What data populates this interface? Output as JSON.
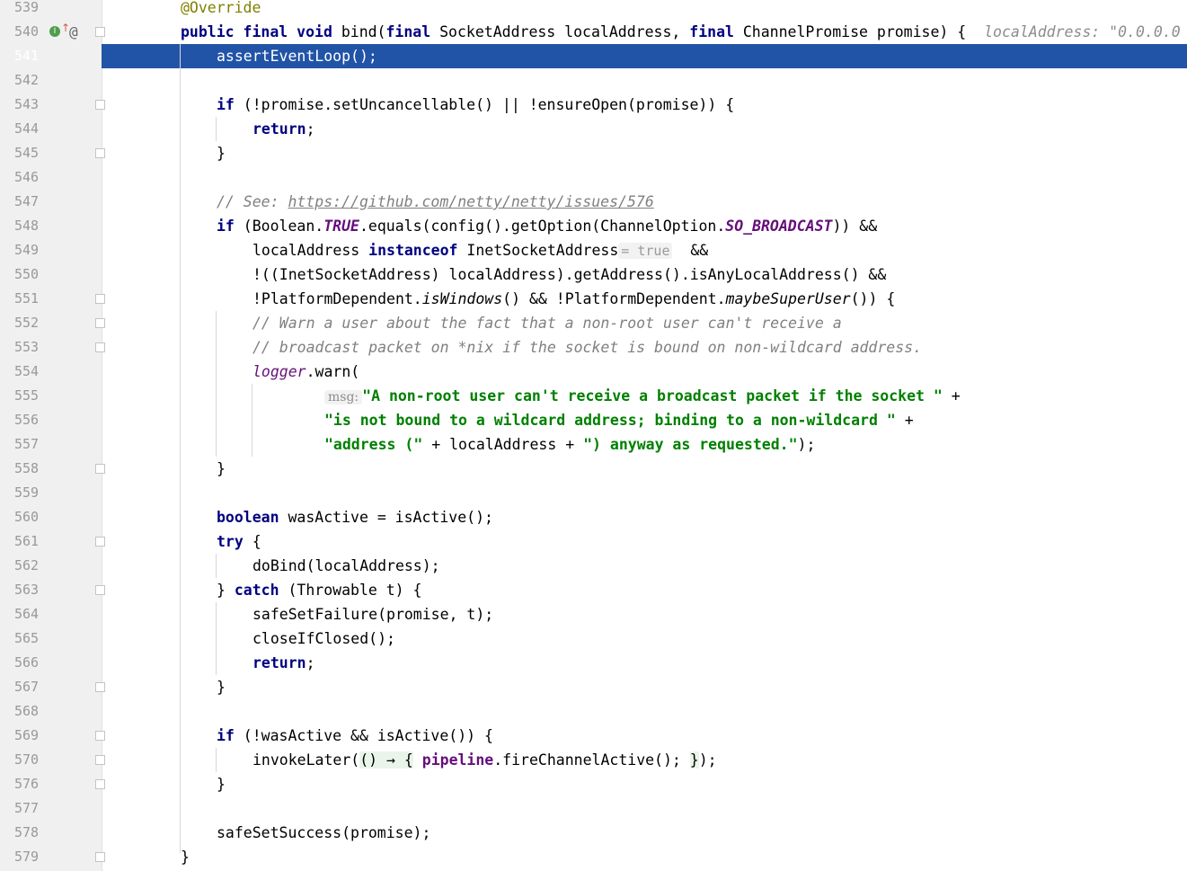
{
  "editor": {
    "line_numbers": [
      "539",
      "540",
      "541",
      "542",
      "543",
      "544",
      "545",
      "546",
      "547",
      "548",
      "549",
      "550",
      "551",
      "552",
      "553",
      "554",
      "555",
      "556",
      "557",
      "558",
      "559",
      "560",
      "561",
      "562",
      "563",
      "564",
      "565",
      "566",
      "567",
      "568",
      "569",
      "570",
      "576",
      "577",
      "578",
      "579"
    ],
    "gutter_icons": {
      "implements_icon": "I",
      "override_icon": "@"
    },
    "code": {
      "l539": {
        "ann": "@Override"
      },
      "l540": {
        "kw1": "public final void",
        "t1": " bind(",
        "kw2": "final",
        "t2": " SocketAddress localAddress, ",
        "kw3": "final",
        "t3": " ChannelPromise promise) {",
        "inlay": "  localAddress: \"0.0.0.0"
      },
      "l541": {
        "t1": "assertEventLoop();"
      },
      "l543": {
        "kw1": "if",
        "t1": " (!promise.setUncancellable() || !ensureOpen(promise)) {"
      },
      "l544": {
        "kw1": "return",
        "t1": ";"
      },
      "l545": {
        "t1": "}"
      },
      "l547": {
        "c1": "// See: ",
        "link": "https://github.com/netty/netty/issues/576"
      },
      "l548": {
        "kw1": "if",
        "t1": " (Boolean.",
        "sf1": "TRUE",
        "t2": ".equals(config().getOption(ChannelOption.",
        "sf2": "SO_BROADCAST",
        "t3": ")) &&"
      },
      "l549": {
        "t1": "localAddress ",
        "kw1": "instanceof",
        "t2": " InetSocketAddress",
        "hint": "= true",
        "t3": "  &&"
      },
      "l550": {
        "t1": "!((InetSocketAddress) localAddress).getAddress().isAnyLocalAddress() &&"
      },
      "l551": {
        "t1": "!PlatformDependent.",
        "i1": "isWindows",
        "t2": "() && !PlatformDependent.",
        "i2": "maybeSuperUser",
        "t3": "()) {"
      },
      "l552": {
        "c1": "// Warn a user about the fact that a non-root user can't receive a"
      },
      "l553": {
        "c1": "// broadcast packet on *nix if the socket is bound on non-wildcard address."
      },
      "l554": {
        "f1": "logger",
        "t1": ".warn("
      },
      "l555": {
        "hint": "msg:",
        "s1": "\"A non-root user can't receive a broadcast packet if the socket \"",
        "t1": " +"
      },
      "l556": {
        "s1": "\"is not bound to a wildcard address; binding to a non-wildcard \"",
        "t1": " +"
      },
      "l557": {
        "s1": "\"address (\"",
        "t1": " + localAddress + ",
        "s2": "\") anyway as requested.\"",
        "t2": ");"
      },
      "l558": {
        "t1": "}"
      },
      "l560": {
        "kw1": "boolean",
        "t1": " wasActive = isActive();"
      },
      "l561": {
        "kw1": "try",
        "t1": " {"
      },
      "l562": {
        "t1": "doBind(localAddress);"
      },
      "l563": {
        "t1": "} ",
        "kw1": "catch",
        "t2": " (Throwable t) {"
      },
      "l564": {
        "t1": "safeSetFailure(promise, t);"
      },
      "l565": {
        "t1": "closeIfClosed();"
      },
      "l566": {
        "kw1": "return",
        "t1": ";"
      },
      "l567": {
        "t1": "}"
      },
      "l569": {
        "kw1": "if",
        "t1": " (!wasActive && isActive()) {"
      },
      "l570": {
        "t1": "invokeLater(",
        "lam1": "() → {",
        "t2": " ",
        "f1": "pipeline",
        "t3": ".fireChannelActive(); ",
        "lam2": "}",
        "t4": ");"
      },
      "l576": {
        "t1": "}"
      },
      "l578": {
        "t1": "safeSetSuccess(promise);"
      },
      "l579": {
        "t1": "}"
      }
    }
  }
}
